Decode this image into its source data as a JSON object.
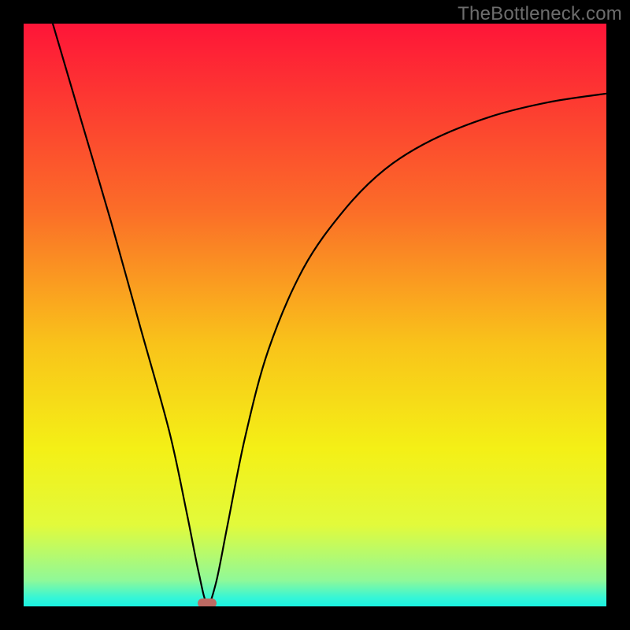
{
  "watermark": "TheBottleneck.com",
  "chart_data": {
    "type": "line",
    "title": "",
    "xlabel": "",
    "ylabel": "",
    "xlim": [
      0,
      100
    ],
    "ylim": [
      0,
      100
    ],
    "grid": false,
    "series": [
      {
        "name": "bottleneck-curve",
        "x": [
          5,
          10,
          15,
          20,
          25,
          28,
          30,
          31.5,
          33,
          35,
          38,
          42,
          48,
          55,
          62,
          70,
          80,
          90,
          100
        ],
        "values": [
          100,
          83,
          66,
          48,
          30,
          16,
          6,
          0.5,
          4,
          14,
          29,
          44,
          58,
          68,
          75,
          80,
          84,
          86.5,
          88
        ]
      }
    ],
    "annotations": [
      {
        "name": "min-marker",
        "x": 31.5,
        "y": 0.5,
        "shape": "pill",
        "color": "#bd6a63"
      }
    ],
    "background_gradient": {
      "direction": "vertical",
      "stops": [
        {
          "offset": 0.0,
          "color": "#fe1538"
        },
        {
          "offset": 0.32,
          "color": "#fb6d28"
        },
        {
          "offset": 0.55,
          "color": "#f9c31a"
        },
        {
          "offset": 0.73,
          "color": "#f4f016"
        },
        {
          "offset": 0.86,
          "color": "#e2fa3b"
        },
        {
          "offset": 0.955,
          "color": "#90f998"
        },
        {
          "offset": 0.985,
          "color": "#36f6d6"
        },
        {
          "offset": 1.0,
          "color": "#1af2e2"
        }
      ]
    }
  }
}
